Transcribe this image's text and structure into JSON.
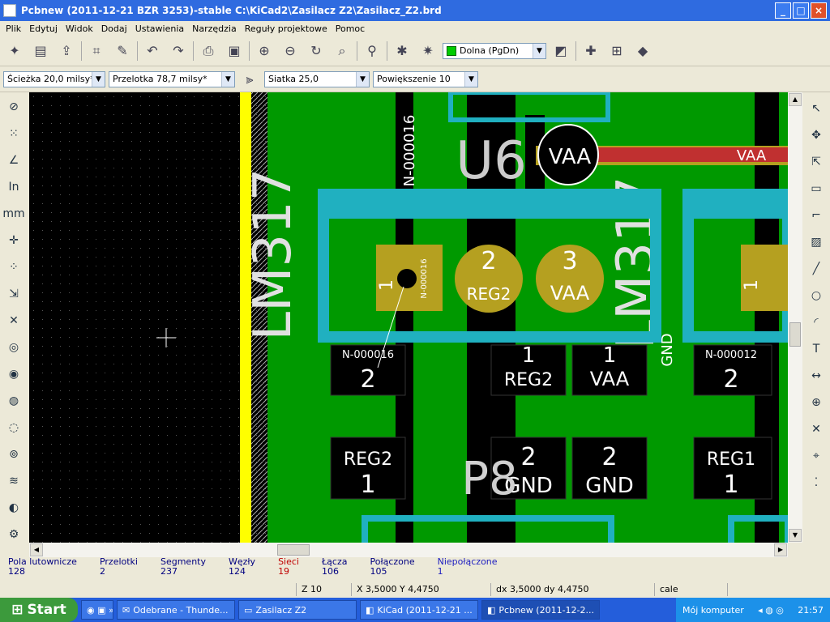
{
  "title": "Pcbnew (2011-12-21 BZR 3253)-stable C:\\KiCad2\\Zasilacz Z2\\Zasilacz_Z2.brd",
  "menu": [
    "Plik",
    "Edytuj",
    "Widok",
    "Dodaj",
    "Ustawienia",
    "Narzędzia",
    "Reguły projektowe",
    "Pomoc"
  ],
  "toolbar1": {
    "layer": "Dolna (PgDn)",
    "layer_color": "#00cc00"
  },
  "toolbar2": {
    "track": "Ścieżka 20,0 milsy*",
    "via": "Przelotka 78,7 milsy*",
    "grid": "Siatka 25,0",
    "zoom": "Powiększenie 10"
  },
  "status": [
    {
      "label": "Pola lutownicze",
      "value": "128",
      "color": "#000080"
    },
    {
      "label": "Przelotki",
      "value": "2",
      "color": "#000080"
    },
    {
      "label": "Segmenty",
      "value": "237",
      "color": "#000080"
    },
    {
      "label": "Węzły",
      "value": "124",
      "color": "#000080"
    },
    {
      "label": "Sieci",
      "value": "19",
      "color": "#c00000"
    },
    {
      "label": "Łącza",
      "value": "106",
      "color": "#000080"
    },
    {
      "label": "Połączone",
      "value": "105",
      "color": "#000080"
    },
    {
      "label": "Niepołączone",
      "value": "1",
      "color": "#2020c0"
    }
  ],
  "coords": {
    "z": "Z 10",
    "xy": "X 3,5000  Y 4,4750",
    "dxy": "dx 3,5000  dy 4,4750",
    "unit": "cale"
  },
  "taskbar": {
    "start": "Start",
    "tasks": [
      "Odebrane - Thunde...",
      "Zasilacz Z2",
      "KiCad (2011-12-21 ...",
      "Pcbnew (2011-12-2..."
    ],
    "tray_label": "Mój komputer",
    "clock": "21:57"
  },
  "pcb": {
    "labels": {
      "u6": "U6",
      "lm317": "LM317",
      "vaa": "VAA",
      "p8": "P8",
      "gnd": "GND",
      "reg2": "REG2",
      "reg1": "REG1",
      "n16": "N-000016",
      "n12": "N-000012",
      "one": "1",
      "two": "2",
      "three": "3"
    }
  }
}
